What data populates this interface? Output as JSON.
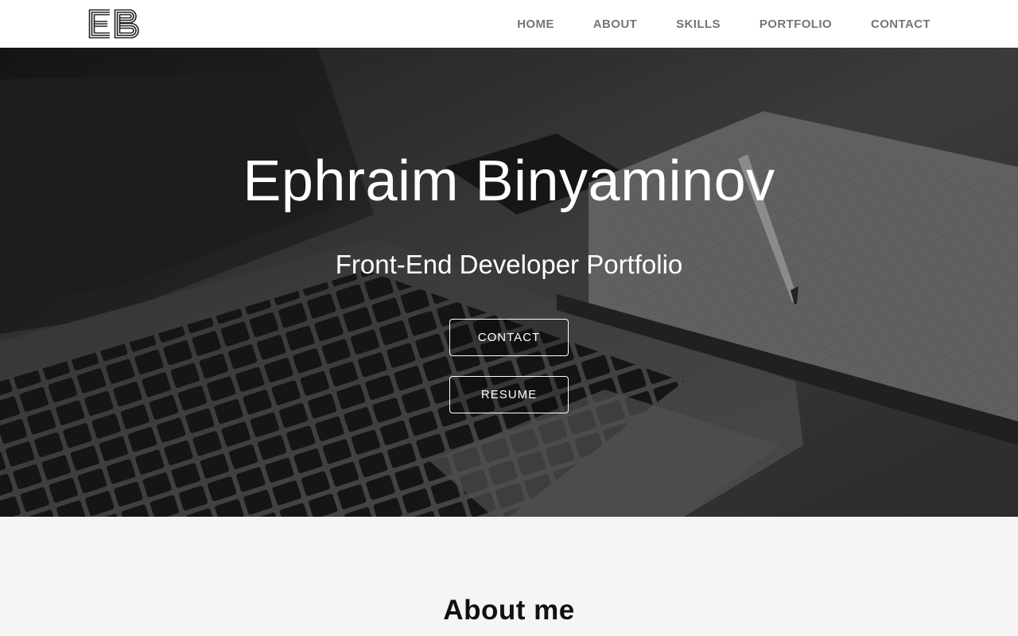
{
  "navbar": {
    "logo_text": "EB",
    "links": [
      "HOME",
      "ABOUT",
      "SKILLS",
      "PORTFOLIO",
      "CONTACT"
    ]
  },
  "hero": {
    "title": "Ephraim Binyaminov",
    "subtitle": "Front-End Developer Portfolio",
    "buttons": {
      "contact": "CONTACT",
      "resume": "RESUME"
    },
    "background_icon": "laptop-and-notebook-photo"
  },
  "about": {
    "title": "About me"
  },
  "colors": {
    "nav_text": "#757575",
    "hero_text": "#ffffff",
    "section_bg": "#f5f5f5",
    "heading": "#111111"
  }
}
